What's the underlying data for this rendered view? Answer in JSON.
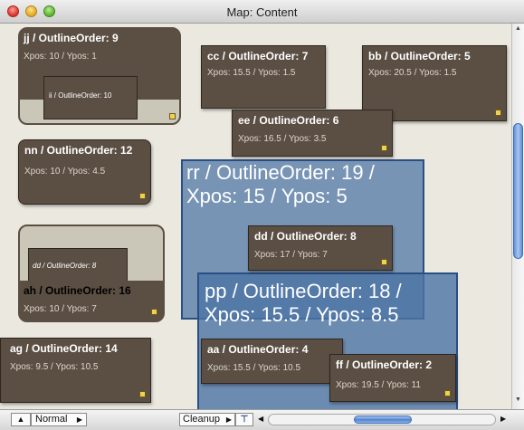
{
  "window": {
    "title": "Map: Content"
  },
  "nodes": {
    "jj": {
      "title": "jj / OutlineOrder: 9",
      "sub": "Xpos: 10 / Ypos: 1",
      "inner": "ii / OutlineOrder: 10"
    },
    "cc": {
      "title": "cc / OutlineOrder: 7",
      "sub": "Xpos: 15.5 / Ypos: 1.5"
    },
    "bb": {
      "title": "bb / OutlineOrder: 5",
      "sub": "Xpos: 20.5 / Ypos: 1.5"
    },
    "ee": {
      "title": "ee / OutlineOrder: 6",
      "sub": "Xpos: 16.5 / Ypos: 3.5"
    },
    "nn": {
      "title": "nn / OutlineOrder: 12",
      "sub": "Xpos: 10 / Ypos: 4.5"
    },
    "rr": {
      "title": "rr / OutlineOrder: 19 / Xpos: 15 / Ypos: 5"
    },
    "dd": {
      "title": "dd / OutlineOrder: 8",
      "sub": "Xpos: 17 / Ypos: 7"
    },
    "ah": {
      "title": "ah / OutlineOrder: 16",
      "sub": "Xpos: 10 / Ypos: 7",
      "inner": "dd / OutlineOrder: 8"
    },
    "pp": {
      "title": "pp / OutlineOrder: 18 / Xpos: 15.5 / Ypos: 8.5"
    },
    "ag": {
      "title": "ag / OutlineOrder: 14",
      "sub": "Xpos: 9.5 / Ypos: 10.5"
    },
    "aa": {
      "title": "aa / OutlineOrder: 4",
      "sub": "Xpos: 15.5 / Ypos: 10.5"
    },
    "ff": {
      "title": "ff / OutlineOrder: 2",
      "sub": "Xpos: 19.5 / Ypos: 11"
    }
  },
  "bottombar": {
    "view_mode": "Normal",
    "cleanup_label": "Cleanup"
  },
  "icons": {
    "up_arrow": "▲",
    "menu_arrow": "▶",
    "scroll_left": "◀",
    "scroll_right": "▶",
    "pin": "⊤"
  },
  "colors": {
    "node_fill": "#5b4f44",
    "canvas": "#ebe9df",
    "adornment": "#4b73a5",
    "resize_handle": "#f0d050"
  }
}
